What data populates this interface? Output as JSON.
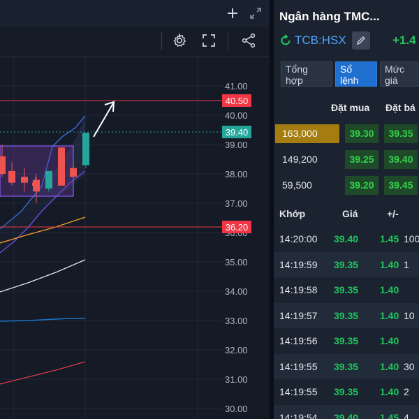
{
  "chart": {
    "price_labels": [
      "41.00",
      "40.00",
      "39.00",
      "38.00",
      "37.00",
      "36.00",
      "35.00",
      "34.00",
      "33.00",
      "32.00",
      "31.00",
      "30.00"
    ],
    "tags": [
      {
        "label": "40.50",
        "color": "#f23645"
      },
      {
        "label": "39.40",
        "color": "#26a69a"
      },
      {
        "label": "36.20",
        "color": "#f23645"
      }
    ],
    "chart_data": {
      "type": "candlestick",
      "series": [
        {
          "open": 38.6,
          "high": 39.0,
          "low": 37.9,
          "close": 38.0,
          "color": "#ef5350"
        },
        {
          "open": 38.1,
          "high": 38.4,
          "low": 37.6,
          "close": 37.7,
          "color": "#ef5350"
        },
        {
          "open": 37.9,
          "high": 38.2,
          "low": 37.4,
          "close": 37.7,
          "color": "#ef5350"
        },
        {
          "open": 37.7,
          "high": 38.0,
          "low": 37.5,
          "close": 37.6,
          "color": "#ef5350"
        },
        {
          "open": 37.8,
          "high": 37.9,
          "low": 37.0,
          "close": 37.4,
          "color": "#ef5350"
        },
        {
          "open": 37.5,
          "high": 38.1,
          "low": 37.4,
          "close": 38.1,
          "color": "#26a69a"
        },
        {
          "open": 38.9,
          "high": 38.9,
          "low": 37.6,
          "close": 37.6,
          "color": "#ef5350"
        },
        {
          "open": 38.2,
          "high": 38.4,
          "low": 37.9,
          "close": 37.9,
          "color": "#ef5350"
        },
        {
          "open": 38.3,
          "high": 39.4,
          "low": 38.2,
          "close": 39.4,
          "color": "#26a69a"
        }
      ]
    }
  },
  "panel": {
    "title": "Ngân hàng TMC...",
    "ticker": "TCB:HSX",
    "change": "+1.4",
    "tabs": [
      "Tổng hợp",
      "Sổ lệnh",
      "Mức giá"
    ],
    "orderbook_headers": {
      "bid": "Đặt mua",
      "ask": "Đặt bá"
    },
    "orderbook": [
      {
        "vol": "163,000",
        "bid": "39.30",
        "ask": "39.35"
      },
      {
        "vol": "149,200",
        "bid": "39.25",
        "ask": "39.40"
      },
      {
        "vol": "59,500",
        "bid": "39.20",
        "ask": "39.45"
      }
    ],
    "match_headers": {
      "time": "Khớp",
      "price": "Giá",
      "change": "+/-"
    },
    "matches": [
      {
        "time": "14:20:00",
        "price": "39.40",
        "change": "1.45",
        "vol": "100"
      },
      {
        "time": "14:19:59",
        "price": "39.35",
        "change": "1.40",
        "vol": "1"
      },
      {
        "time": "14:19:58",
        "price": "39.35",
        "change": "1.40",
        "vol": ""
      },
      {
        "time": "14:19:57",
        "price": "39.35",
        "change": "1.40",
        "vol": "10"
      },
      {
        "time": "14:19:56",
        "price": "39.35",
        "change": "1.40",
        "vol": ""
      },
      {
        "time": "14:19:55",
        "price": "39.35",
        "change": "1.40",
        "vol": "30"
      },
      {
        "time": "14:19:55",
        "price": "39.35",
        "change": "1.40",
        "vol": "2"
      },
      {
        "time": "14:19:54",
        "price": "39.40",
        "change": "1.45",
        "vol": "4"
      }
    ]
  },
  "icons": [
    "plus-icon",
    "expand-icon",
    "gear-icon",
    "fullscreen-icon",
    "share-icon",
    "refresh-icon",
    "pencil-icon"
  ]
}
